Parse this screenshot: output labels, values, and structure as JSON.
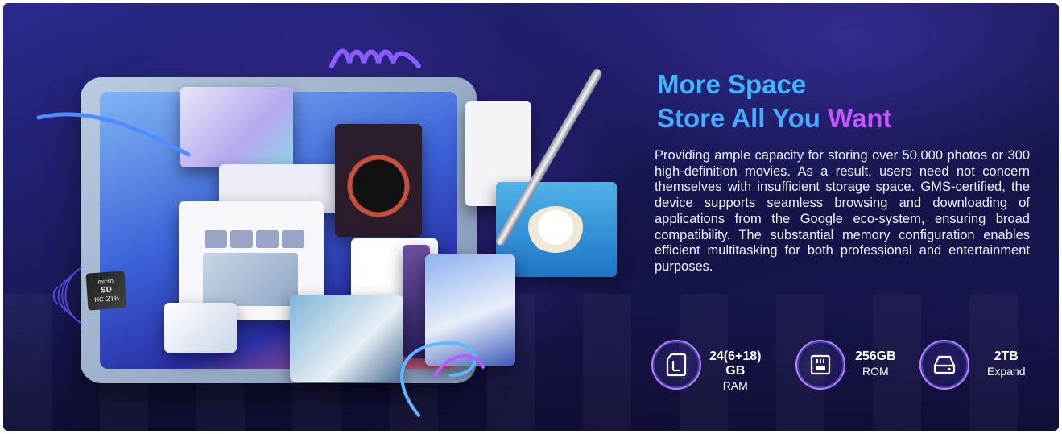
{
  "headline": {
    "line1": "More Space",
    "line2_main": "Store All You ",
    "line2_accent": "Want"
  },
  "description": "Providing ample capacity for storing over 50,000 photos or 300 high-definition movies. As a result, users need not concern themselves with insufficient storage space. GMS-certified, the device supports seamless browsing and downloading of applications from the Google eco-system, ensuring broad compatibility. The substantial memory configuration enables efficient multitasking for both professional and entertainment purposes.",
  "specs": [
    {
      "icon": "sd-card-icon",
      "value": "24(6+18) GB",
      "label": "RAM"
    },
    {
      "icon": "memory-chip-icon",
      "value": "256GB",
      "label": "ROM"
    },
    {
      "icon": "hard-drive-icon",
      "value": "2TB",
      "label": "Expand"
    }
  ],
  "sd_card": {
    "brand": "micro",
    "logo": "SD",
    "class": "HC",
    "capacity": "2TB"
  },
  "colors": {
    "headline_blue": "#3fb6ff",
    "headline_purple": "#c455ff",
    "background_dark": "#141447",
    "ring_accent": "#c77dff"
  }
}
